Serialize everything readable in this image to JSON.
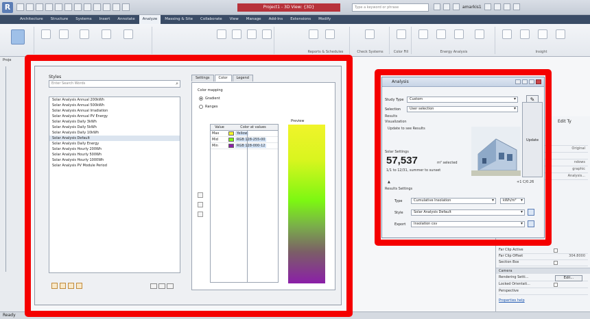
{
  "titlebar": {
    "app_letter": "R",
    "title": "Project1 - 3D View: {3D}",
    "search_placeholder": "Type a keyword or phrase",
    "user": "amarkis1"
  },
  "ribbon": {
    "tabs": [
      "Architecture",
      "Structure",
      "Systems",
      "Insert",
      "Annotate",
      "Analyze",
      "Massing & Site",
      "Collaborate",
      "View",
      "Manage",
      "Add-Ins",
      "Extensions",
      "Modify"
    ],
    "active_tab": "Analyze",
    "groups": [
      "Reports & Schedules",
      "Check Systems",
      "Color Fill",
      "Energy Analysis",
      "Insight"
    ]
  },
  "left_strip": {
    "label": "Proje"
  },
  "styles_dialog": {
    "styles_label": "Styles",
    "filter_placeholder": "Enter Search Words",
    "styles": [
      "Solar Analysis Annual 200kWh",
      "Solar Analysis Annual 500kWh",
      "Solar Analysis Annual Irradiation",
      "Solar Analysis Annual PV Energy",
      "Solar Analysis Daily 3kWh",
      "Solar Analysis Daily 5kWh",
      "Solar Analysis Daily 10kWh",
      "Solar Analysis Default",
      "Solar Analysis Daily Energy",
      "Solar Analysis Hourly 200Wh",
      "Solar Analysis Hourly 500Wh",
      "Solar Analysis Hourly 1000Wh",
      "Solar Analysis PV Module Period"
    ],
    "selected_index": 7,
    "tabs": [
      "Settings",
      "Color",
      "Legend"
    ],
    "active_tab": "Color",
    "color_mapping_label": "Color mapping",
    "gradient_label": "Gradient",
    "ranges_label": "Ranges",
    "gradient_selected": true,
    "table_headers": [
      "Value",
      "Color at values"
    ],
    "color_rows": [
      {
        "label": "Max",
        "color": "#f3f52a",
        "text": "Yellow"
      },
      {
        "label": "Mid",
        "color": "#7cf712",
        "text": "RGB 128-255-00"
      },
      {
        "label": "Min",
        "color": "#8b1fa8",
        "text": "RGB 128-000-12"
      }
    ],
    "preview_label": "Preview"
  },
  "analysis_dialog": {
    "title": "Analysis",
    "study_type_label": "Study Type",
    "study_type": "Custom",
    "selection_label": "Selection",
    "selection": "User selection",
    "results_label": "Results",
    "visualization_label": "Visualization",
    "update_label": "Update to see Results",
    "solar_settings_label": "Solar Settings",
    "area_value": "57,537",
    "area_unit": "m² selected",
    "area_note": "1/1 to 12/31, summer to sunset",
    "update_button": "Update",
    "scale_text": "+1 C/0.26",
    "results_settings_label": "Results Settings",
    "type_label": "Type",
    "type_value": "Cumulative Insolation",
    "unit_value": "kWh/m²",
    "style_label": "Style",
    "style_value": "Solar Analysis Default",
    "export_label": "Export",
    "export_value": "Insolation csv"
  },
  "properties": {
    "edit_type": "Edit Ty",
    "rows": [
      {
        "label": "",
        "value": ""
      },
      {
        "label": "",
        "value": "Original"
      },
      {
        "label": "",
        "value": ""
      },
      {
        "label": "",
        "value": "ndows"
      },
      {
        "label": "",
        "value": "graphic"
      },
      {
        "label": "",
        "value": "Analysis..."
      }
    ],
    "lower_rows": [
      {
        "label": "Far Clip Active",
        "value": ""
      },
      {
        "label": "Far Clip Offset",
        "value": "304.8000"
      },
      {
        "label": "Section Box",
        "value": ""
      }
    ],
    "camera_head": "Camera",
    "rendering_label": "Rendering Setti...",
    "rendering_btn": "Edit...",
    "locked_label": "Locked Orientati...",
    "perspective_label": "Perspective",
    "help_link": "Properties help"
  },
  "status": {
    "text": "Ready"
  },
  "highlight_color": "#f50000"
}
